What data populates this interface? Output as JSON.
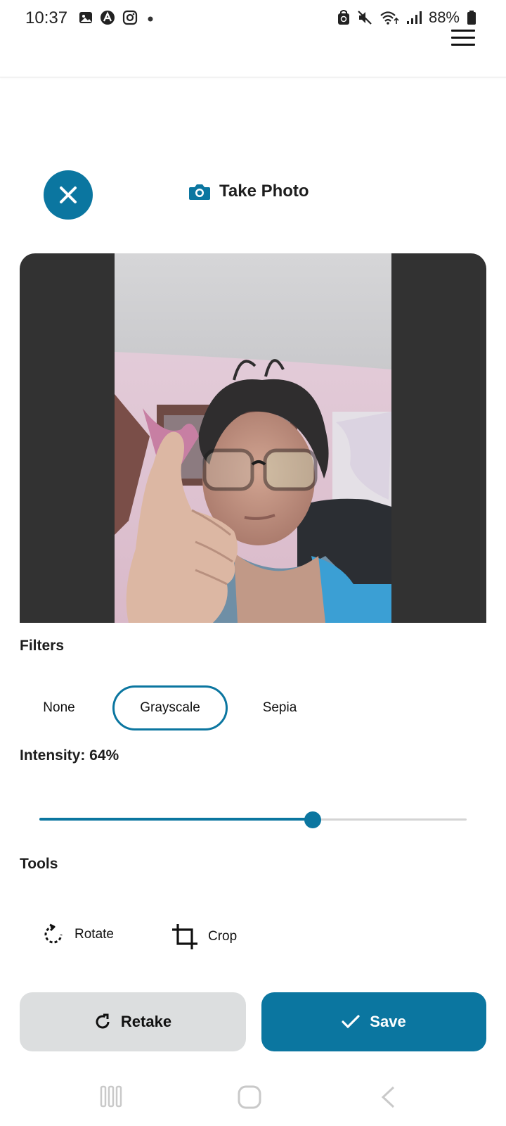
{
  "status_bar": {
    "time": "10:37",
    "battery_percent": "88%",
    "left_icons": [
      "gallery-icon",
      "dark-circle-a-icon",
      "instagram-icon",
      "dot-icon"
    ],
    "right_icons": [
      "recycle-lock-icon",
      "mute-icon",
      "wifi-icon",
      "signal-icon",
      "battery-icon"
    ]
  },
  "header": {
    "menu_icon": "hamburger-menu-icon"
  },
  "top_row": {
    "close_icon": "close-icon",
    "title_icon": "camera-icon",
    "title": "Take Photo"
  },
  "photo": {
    "description_icon": "captured-photo"
  },
  "filters": {
    "label": "Filters",
    "options": [
      "None",
      "Grayscale",
      "Sepia"
    ],
    "selected": "Grayscale"
  },
  "intensity": {
    "label": "Intensity: 64%",
    "value": 0.64
  },
  "tools": {
    "label": "Tools",
    "items": [
      {
        "label": "Rotate",
        "icon": "rotate-icon"
      },
      {
        "label": "Crop",
        "icon": "crop-icon"
      }
    ]
  },
  "actions": {
    "retake_label": "Retake",
    "retake_icon": "refresh-icon",
    "save_label": "Save",
    "save_icon": "check-icon"
  },
  "navigation": {
    "buttons": [
      "recents-icon",
      "home-icon",
      "back-icon"
    ]
  },
  "colors": {
    "accent": "#0b76a0",
    "photo_background": "#323232",
    "retake_background": "#dcdedf"
  }
}
